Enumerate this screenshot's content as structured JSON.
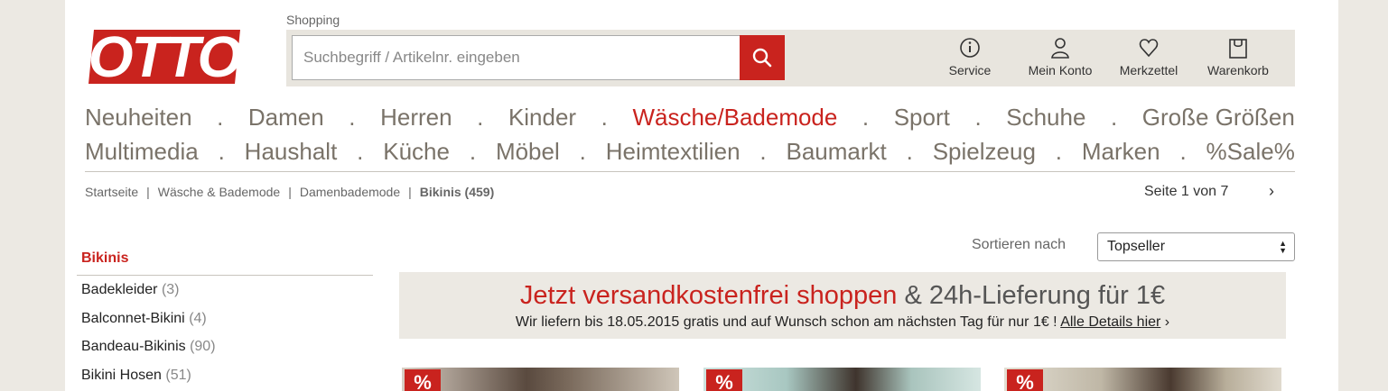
{
  "header": {
    "logo_text": "OTTO",
    "shopping_label": "Shopping",
    "search_placeholder": "Suchbegriff / Artikelnr. eingeben",
    "utilities": [
      {
        "label": "Service",
        "icon": "info-icon"
      },
      {
        "label": "Mein Konto",
        "icon": "user-icon"
      },
      {
        "label": "Merkzettel",
        "icon": "heart-icon"
      },
      {
        "label": "Warenkorb",
        "icon": "shopping-bag-icon"
      }
    ]
  },
  "nav": {
    "row1": [
      "Neuheiten",
      "Damen",
      "Herren",
      "Kinder",
      "Wäsche/Bademode",
      "Sport",
      "Schuhe",
      "Große Größen"
    ],
    "row2": [
      "Multimedia",
      "Haushalt",
      "Küche",
      "Möbel",
      "Heimtextilien",
      "Baumarkt",
      "Spielzeug",
      "Marken",
      "%Sale%"
    ],
    "separator": "."
  },
  "breadcrumb": {
    "items": [
      "Startseite",
      "Wäsche & Bademode",
      "Damenbademode",
      "Bikinis (459)"
    ],
    "separator": "|"
  },
  "pager": {
    "label": "Seite 1 von 7",
    "next": "›"
  },
  "sidebar": {
    "title": "Bikinis",
    "items": [
      {
        "label": "Badekleider",
        "count": "(3)"
      },
      {
        "label": "Balconnet-Bikini",
        "count": "(4)"
      },
      {
        "label": "Bandeau-Bikinis",
        "count": "(90)"
      },
      {
        "label": "Bikini Hosen",
        "count": "(51)"
      }
    ]
  },
  "sort": {
    "label": "Sortieren nach",
    "selected": "Topseller"
  },
  "banner": {
    "headline_red": "Jetzt versandkostenfrei shoppen",
    "headline_grey": "& 24h-Lieferung für 1€",
    "subline": "Wir liefern bis 18.05.2015 gratis und auf Wunsch schon am nächsten Tag für nur 1€ !",
    "link": "Alle Details hier",
    "link_arrow": "›"
  },
  "tiles": [
    {
      "badge": "%"
    },
    {
      "badge": "%"
    },
    {
      "badge": "%"
    }
  ],
  "colors": {
    "brand_red": "#c9231e",
    "nav_grey": "#7a7369",
    "page_bg": "#ece9e3"
  }
}
